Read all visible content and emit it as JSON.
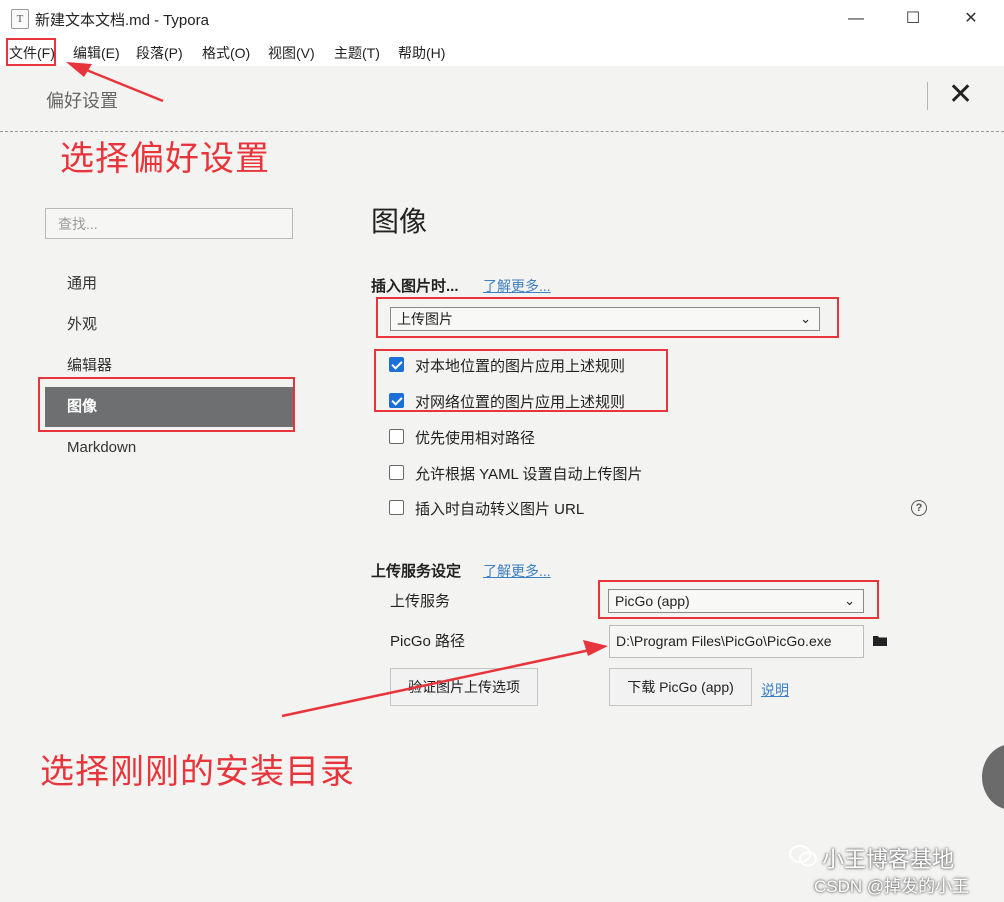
{
  "window": {
    "title": "新建文本文档.md - Typora",
    "app_icon": "T",
    "controls": {
      "minimize": "—",
      "maximize": "☐",
      "close": "✕"
    }
  },
  "menu": [
    "文件(F)",
    "编辑(E)",
    "段落(P)",
    "格式(O)",
    "视图(V)",
    "主题(T)",
    "帮助(H)"
  ],
  "preferences": {
    "title": "偏好设置",
    "search_placeholder": "查找...",
    "nav": [
      "通用",
      "外观",
      "编辑器",
      "图像",
      "Markdown"
    ],
    "active_nav": "图像"
  },
  "image_section": {
    "heading": "图像",
    "insert_label": "插入图片时...",
    "learn_more": "了解更多...",
    "insert_action": "上传图片",
    "checkboxes": [
      {
        "label": "对本地位置的图片应用上述规则",
        "checked": true
      },
      {
        "label": "对网络位置的图片应用上述规则",
        "checked": true
      },
      {
        "label": "优先使用相对路径",
        "checked": false
      },
      {
        "label": "允许根据 YAML 设置自动上传图片",
        "checked": false
      },
      {
        "label": "插入时自动转义图片 URL",
        "checked": false
      }
    ],
    "help_icon": "?"
  },
  "upload_section": {
    "heading": "上传服务设定",
    "learn_more": "了解更多...",
    "service_label": "上传服务",
    "service_value": "PicGo (app)",
    "path_label": "PicGo 路径",
    "path_value": "D:\\Program Files\\PicGo\\PicGo.exe",
    "verify_button": "验证图片上传选项",
    "download_button": "下载 PicGo (app)",
    "explain_link": "说明"
  },
  "annotations": {
    "choose_prefs": "选择偏好设置",
    "choose_dir": "选择刚刚的安装目录",
    "color": "#e8353b"
  },
  "watermark": {
    "main": "小王博客基地",
    "sub": "CSDN @掉发的小王"
  }
}
